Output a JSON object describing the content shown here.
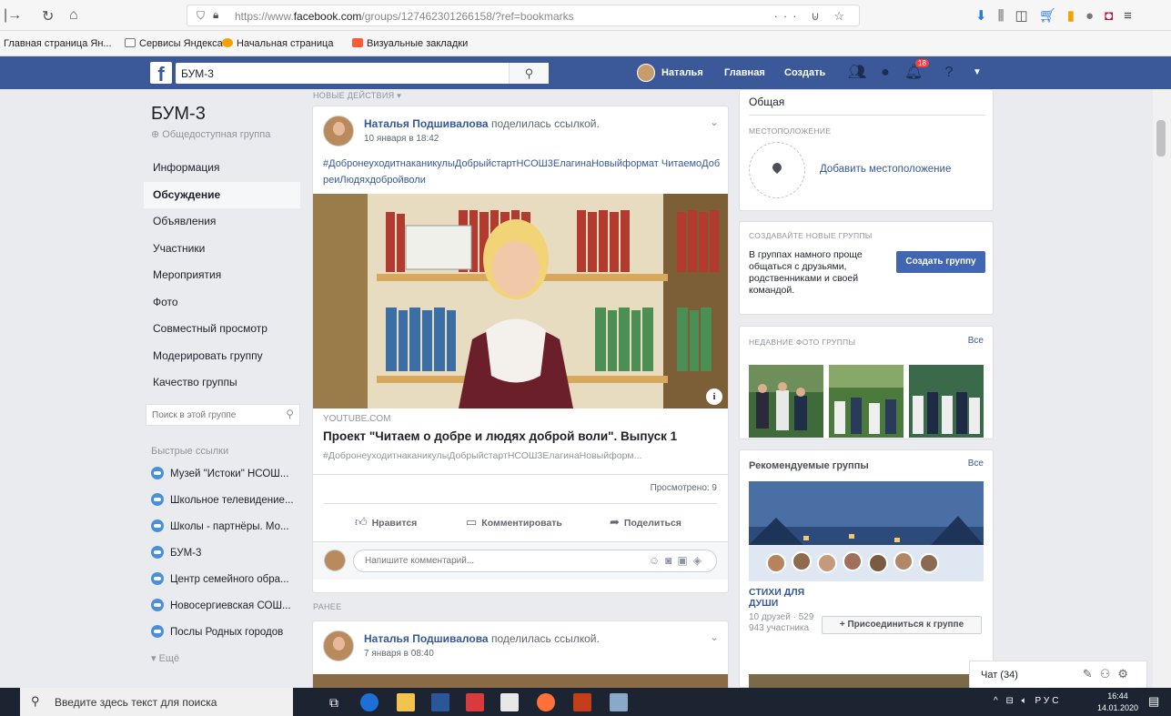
{
  "browser": {
    "url_prefix": "https://www.",
    "url_domain": "facebook.com",
    "url_path": "/groups/127462301266158/?ref=bookmarks",
    "url_menu": "···",
    "bookmarks": [
      {
        "label": "Главная страница Ян...",
        "color": ""
      },
      {
        "label": "Сервисы Яндекса",
        "color": "#9aa0a6"
      },
      {
        "label": "Начальная страница",
        "color": "#f4a100"
      },
      {
        "label": "Визуальные закладки",
        "color": "#ff5a36"
      }
    ]
  },
  "fb_header": {
    "logo": "f",
    "search_value": "БУМ-3",
    "user_name": "Наталья",
    "home_label": "Главная",
    "create_label": "Создать",
    "notif_count": "18"
  },
  "group": {
    "name": "БУМ-3",
    "type": "Общедоступная группа",
    "nav": [
      {
        "label": "Информация",
        "active": false
      },
      {
        "label": "Обсуждение",
        "active": true
      },
      {
        "label": "Объявления",
        "active": false
      },
      {
        "label": "Участники",
        "active": false
      },
      {
        "label": "Мероприятия",
        "active": false
      },
      {
        "label": "Фото",
        "active": false
      },
      {
        "label": "Совместный просмотр",
        "active": false
      },
      {
        "label": "Модерировать группу",
        "active": false
      },
      {
        "label": "Качество группы",
        "active": false
      }
    ],
    "search_placeholder": "Поиск в этой группе",
    "quick_links_title": "Быстрые ссылки",
    "quick_links": [
      "Музей \"Истоки\" НСОШ...",
      "Школьное телевидение...",
      "Школы - партнёры. Мо...",
      "БУМ-3",
      "Центр семейного обра...",
      "Новосергиевская СОШ...",
      "Послы Родных городов"
    ],
    "more_label": "▾ Ещё"
  },
  "feed": {
    "new_activity_label": "НОВЫЕ ДЕЙСТВИЯ ▾",
    "earlier_label": "РАНЕЕ",
    "post1": {
      "author": "Наталья Подшивалова",
      "action": " поделилась ссылкой.",
      "time": "10 января в 18:42",
      "hashtags": "#ДобронеуходитнаканикулыДобрыйстартНСОШ3ЕлагинаНовыйформат ЧитаемоДобреиЛюдяхдобройволи",
      "link_domain": "YOUTUBE.COM",
      "link_title": "Проект \"Читаем о добре и людях доброй воли\". Выпуск 1",
      "link_desc": "#ДобронеуходитнаканикулыДобрыйстартНСОШ3ЕлагинаНовыйформ...",
      "views": "Просмотрено: 9",
      "like_label": "Нравится",
      "comment_label": "Комментировать",
      "share_label": "Поделиться",
      "comment_placeholder": "Напишите комментарий..."
    },
    "post2": {
      "author": "Наталья Подшивалова",
      "action": " поделилась ссылкой.",
      "time": "7 января в 08:40"
    }
  },
  "right": {
    "privacy_value": "Общая",
    "location_title": "МЕСТОПОЛОЖЕНИЕ",
    "add_location": "Добавить местоположение",
    "create_groups_title": "СОЗДАВАЙТЕ НОВЫЕ ГРУППЫ",
    "create_groups_text": "В группах намного проще общаться с друзьями, родственниками и своей командой.",
    "create_group_button": "Создать группу",
    "recent_photos_title": "НЕДАВНИЕ ФОТО ГРУППЫ",
    "all_label": "Все",
    "recommended_title": "Рекомендуемые группы",
    "recommended_group_name": "СТИХИ ДЛЯ ДУШИ",
    "recommended_friends": "10 друзей ·",
    "recommended_members": "529 943 участника",
    "join_button": "+ Присоединиться к группе"
  },
  "chat": {
    "label": "Чат (34)"
  },
  "taskbar": {
    "search_text": "Введите здесь текст для поиска",
    "lang": "РУС",
    "time": "16:44",
    "date": "14.01.2020"
  },
  "colors": {
    "fb_blue": "#3b5998",
    "link": "#365899",
    "button": "#4267b2"
  }
}
